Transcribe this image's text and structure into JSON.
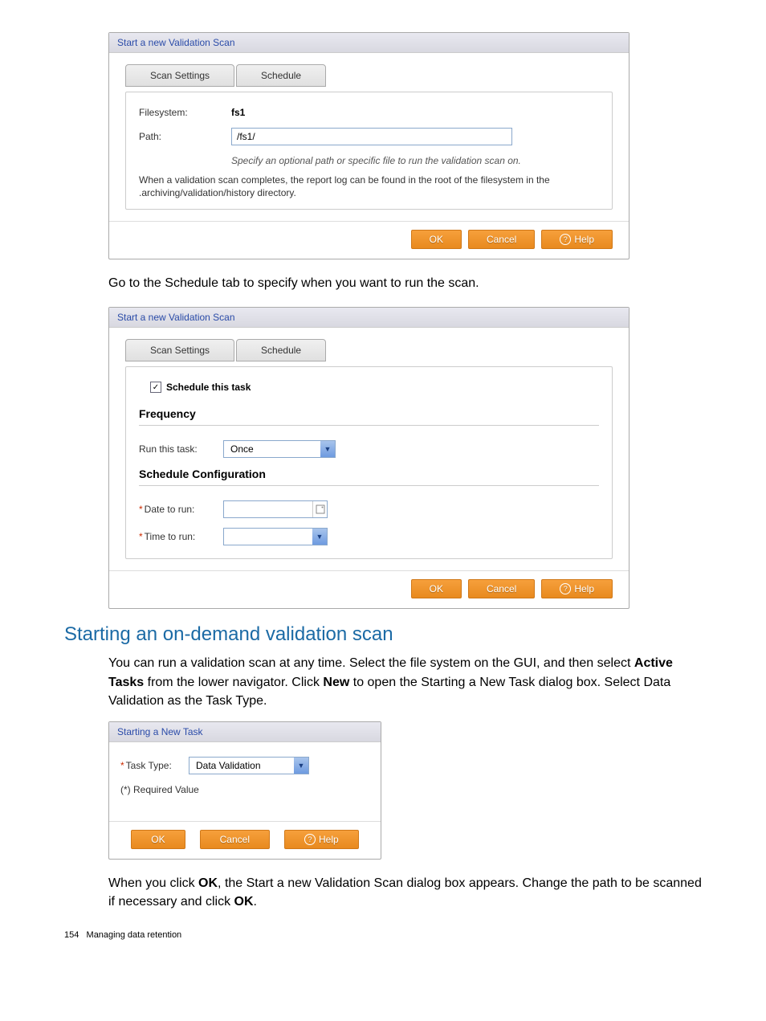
{
  "dialog1": {
    "title": "Start a new Validation Scan",
    "tabs": {
      "scan_settings": "Scan Settings",
      "schedule": "Schedule"
    },
    "filesystem": {
      "label": "Filesystem:",
      "value": "fs1"
    },
    "path": {
      "label": "Path:",
      "value": "/fs1/"
    },
    "hint": "Specify an optional path or specific file to run the validation scan on.",
    "info": "When a validation scan completes, the report log can be found in the root of the filesystem in the .archiving/validation/history directory.",
    "buttons": {
      "ok": "OK",
      "cancel": "Cancel",
      "help": "Help"
    }
  },
  "instruction1": "Go to the Schedule tab to specify when you want to run the scan.",
  "dialog2": {
    "title": "Start a new Validation Scan",
    "tabs": {
      "scan_settings": "Scan Settings",
      "schedule": "Schedule"
    },
    "schedule_checkbox": "Schedule this task",
    "frequency_heading": "Frequency",
    "run_label": "Run this task:",
    "run_value": "Once",
    "sched_cfg_heading": "Schedule Configuration",
    "date_label": "Date to run:",
    "time_label": "Time to run:",
    "buttons": {
      "ok": "OK",
      "cancel": "Cancel",
      "help": "Help"
    }
  },
  "heading": "Starting an on-demand validation scan",
  "para1_a": "You can run a validation scan at any time. Select the file system on the GUI, and then select ",
  "para1_b": "Active Tasks",
  "para1_c": " from the lower navigator. Click ",
  "para1_d": "New",
  "para1_e": " to open the Starting a New Task dialog box. Select Data Validation as the Task Type.",
  "dialog3": {
    "title": "Starting a New Task",
    "task_label": "Task Type:",
    "task_value": "Data Validation",
    "required": "(*) Required Value",
    "buttons": {
      "ok": "OK",
      "cancel": "Cancel",
      "help": "Help"
    }
  },
  "para2_a": "When you click ",
  "para2_b": "OK",
  "para2_c": ", the Start a new Validation Scan dialog box appears. Change the path to be scanned if necessary and click ",
  "para2_d": "OK",
  "para2_e": ".",
  "footer": {
    "page": "154",
    "title": "Managing data retention"
  },
  "glyphs": {
    "check": "✓",
    "down": "▼"
  }
}
